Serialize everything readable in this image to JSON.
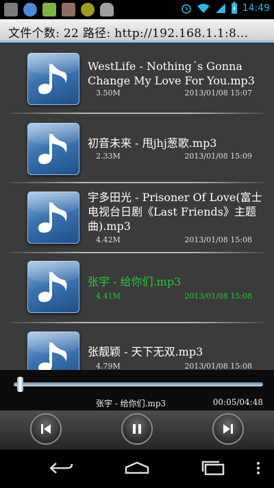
{
  "status": {
    "time": "14:49"
  },
  "header": {
    "text": "文件个数: 22  路径: http://192.168.1.1:8..."
  },
  "songs": [
    {
      "title": "WestLife - Nothing´s Gonna Change My Love For You.mp3",
      "size": "3.50M",
      "date": "2013/01/08 15:07"
    },
    {
      "title": "初音未来 - 甩jhj葱歌.mp3",
      "size": "2.33M",
      "date": "2013/01/08 15:09"
    },
    {
      "title": "宇多田光 - Prisoner Of Love(富士电视台日剧《Last Friends》主题曲).mp3",
      "size": "4.42M",
      "date": "2013/01/08 15:08"
    },
    {
      "title": "张宇 - 给你们.mp3",
      "size": "4.41M",
      "date": "2013/01/08 15:08",
      "active": true
    },
    {
      "title": "张靓颖 - 天下无双.mp3",
      "size": "4.79M",
      "date": "2013/01/08 15:08"
    }
  ],
  "player": {
    "now_title": "张宇 - 给你们.mp3",
    "time": "00:05/04:48",
    "progress": 0.017
  },
  "colors": {
    "accent": "#33b5e5",
    "active_text": "#23c93a",
    "list_bg": "#3b3b3b"
  },
  "icons": [
    "music-note-icon",
    "previous-icon",
    "pause-icon",
    "next-icon",
    "back-icon",
    "home-icon",
    "recent-apps-icon",
    "menu-icon"
  ]
}
